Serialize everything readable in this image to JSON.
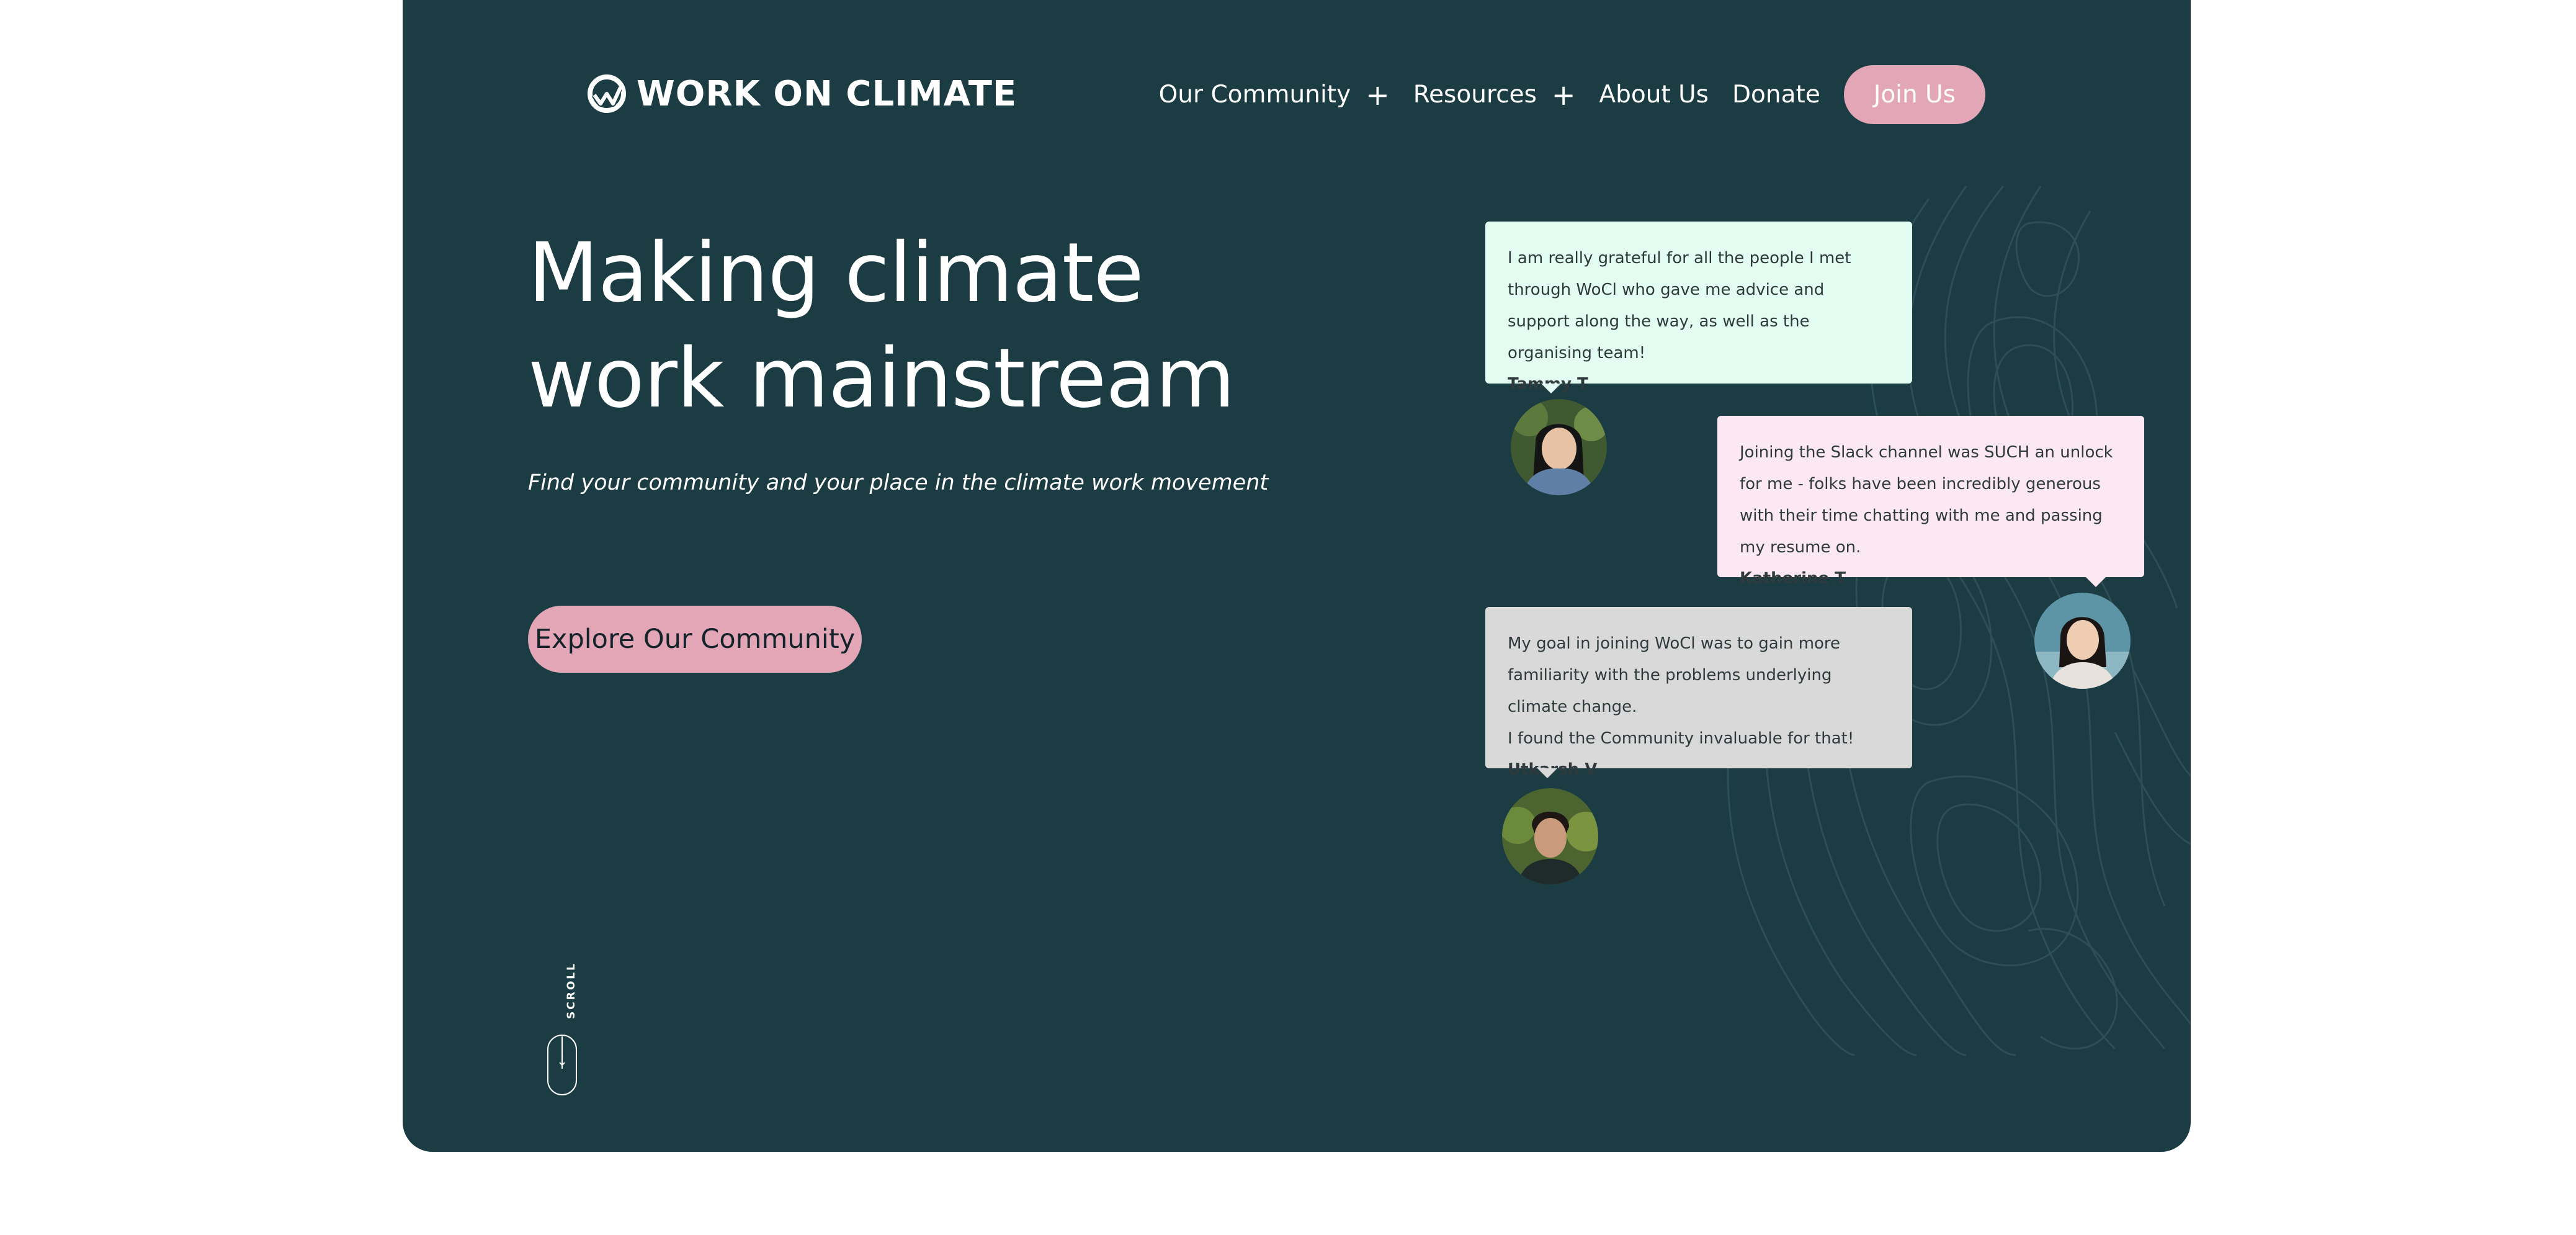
{
  "brand": {
    "name": "WORK ON CLIMATE",
    "logo_icon": "wave-circle-logo-icon",
    "colors": {
      "background": "#1c3c44",
      "accent": "#e2a6b7",
      "text": "#ffffff"
    }
  },
  "nav": {
    "items": [
      {
        "label": "Our Community",
        "has_submenu": true
      },
      {
        "label": "Resources",
        "has_submenu": true
      },
      {
        "label": "About Us",
        "has_submenu": false
      },
      {
        "label": "Donate",
        "has_submenu": false
      }
    ],
    "submenu_icon": "plus-icon",
    "join_label": "Join Us"
  },
  "hero": {
    "headline": "Making climate work mainstream",
    "subheadline": "Find your community and your place in the climate work movement",
    "cta_label": "Explore Our Community"
  },
  "scroll": {
    "label": "SCROLL",
    "icon": "mouse-scroll-icon"
  },
  "testimonials": [
    {
      "quote": "I am really grateful for all the people I met through WoCl who gave me advice and support along the way, as well as the organising team!",
      "author": "Tammy T",
      "color": "#e3fcf1"
    },
    {
      "quote": "Joining the Slack channel was SUCH an unlock for me - folks have been incredibly generous with their time chatting with me and passing my resume on.",
      "author": "Katherine T",
      "color": "#fce8f0"
    },
    {
      "quote_lines": [
        "My goal in joining WoCl was to gain more familiarity with the problems underlying climate change.",
        "I found the Community invaluable for that!"
      ],
      "author": "Utkarsh V",
      "color": "#d9d9d9"
    }
  ]
}
